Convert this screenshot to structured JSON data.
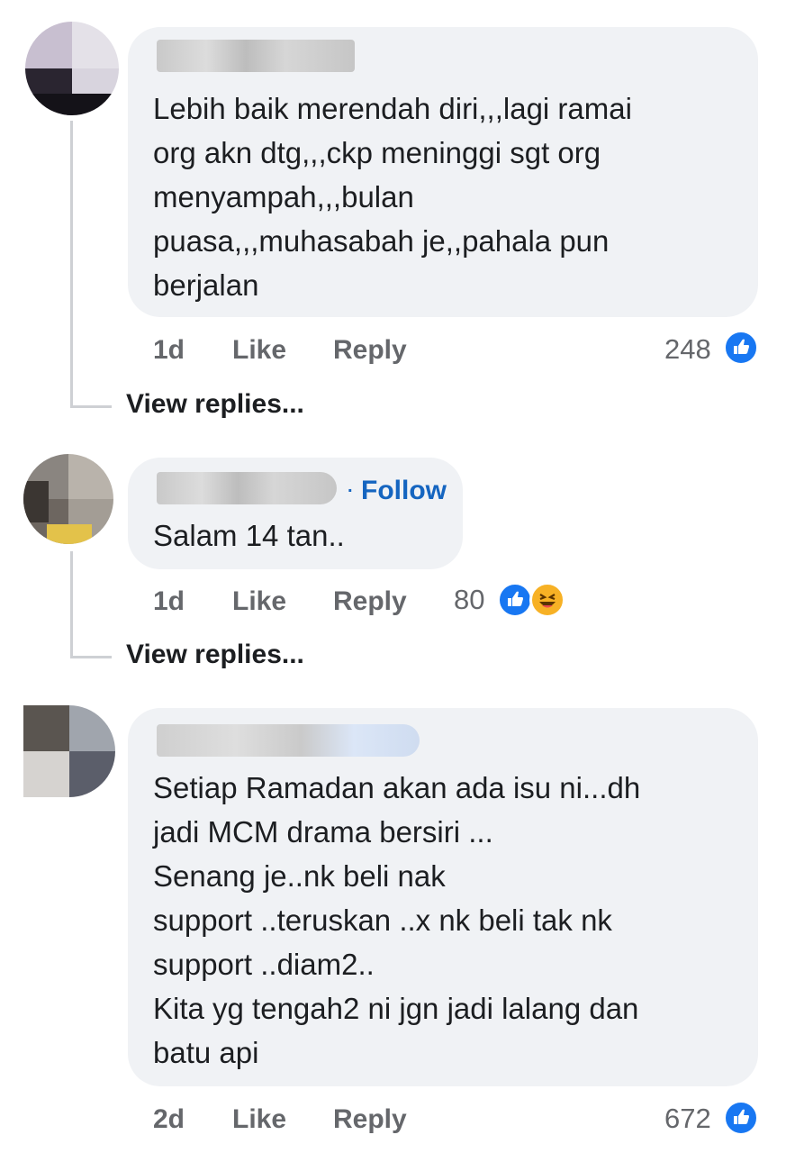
{
  "comments": [
    {
      "lines": [
        "Lebih baik merendah diri,,,lagi ramai",
        "org akn dtg,,,ckp meninggi sgt org",
        "menyampah,,,bulan",
        "puasa,,,muhasabah je,,pahala pun",
        "berjalan"
      ],
      "time": "1d",
      "like_label": "Like",
      "reply_label": "Reply",
      "reaction_count": "248",
      "reaction_icons": [
        "like-icon"
      ],
      "view_replies": "View replies..."
    },
    {
      "follow_label": "Follow",
      "lines": [
        "Salam 14 tan.."
      ],
      "time": "1d",
      "like_label": "Like",
      "reply_label": "Reply",
      "reaction_count": "80",
      "reaction_icons": [
        "like-icon",
        "haha-icon"
      ],
      "view_replies": "View replies..."
    },
    {
      "lines": [
        "Setiap Ramadan akan ada isu ni...dh",
        "jadi MCM drama bersiri ...",
        "Senang je..nk beli nak",
        "support ..teruskan ..x nk beli tak nk",
        "support ..diam2..",
        "Kita yg tengah2 ni jgn jadi lalang dan",
        "batu api"
      ],
      "time": "2d",
      "like_label": "Like",
      "reply_label": "Reply",
      "reaction_count": "672",
      "reaction_icons": [
        "like-icon"
      ]
    }
  ],
  "colors": {
    "bubble": "#f0f2f5",
    "meta": "#65676b",
    "like_blue": "#1877f2",
    "follow_blue": "#1565c0",
    "haha_yellow": "#f7b125"
  }
}
